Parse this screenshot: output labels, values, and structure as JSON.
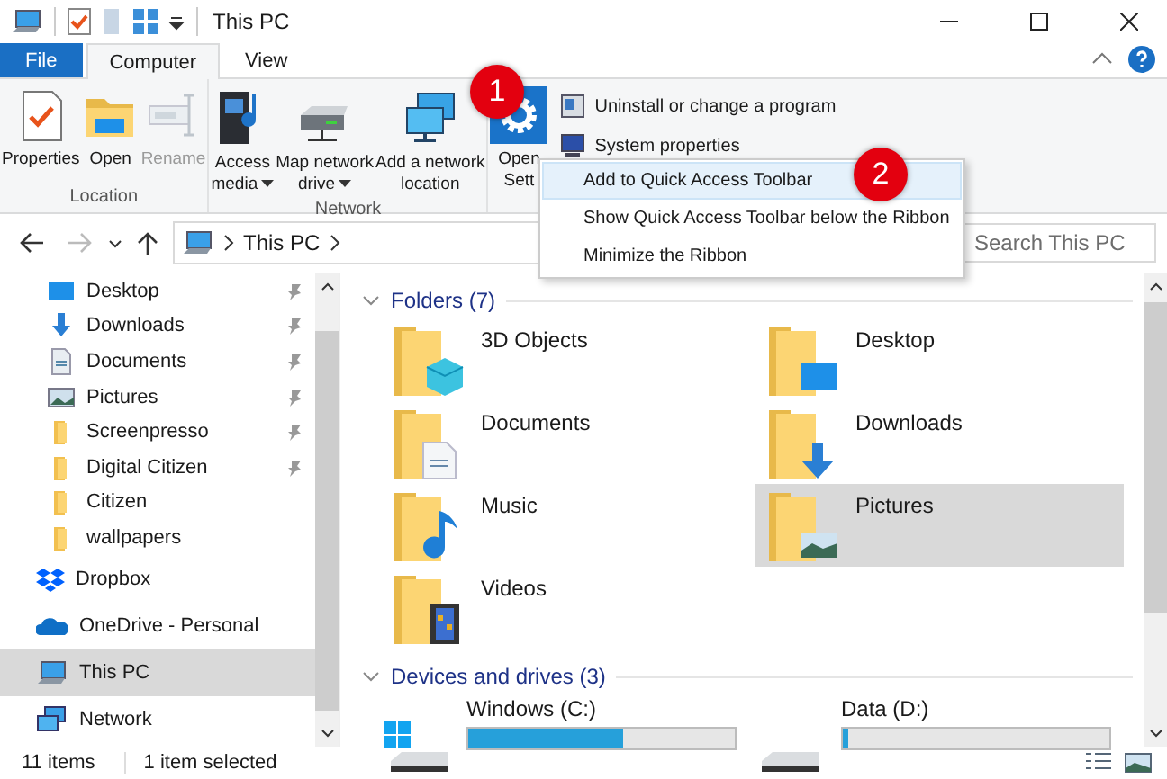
{
  "window": {
    "title": "This PC"
  },
  "tabs": [
    {
      "label": "File",
      "kind": "file",
      "selected": false
    },
    {
      "label": "Computer",
      "kind": "tab",
      "selected": true
    },
    {
      "label": "View",
      "kind": "tab",
      "selected": false
    }
  ],
  "ribbon_groups": [
    {
      "label": "Location",
      "buttons": [
        {
          "lines": [
            "Properties"
          ],
          "kind": "properties",
          "disabled": false,
          "dropdown": false
        },
        {
          "lines": [
            "Open"
          ],
          "kind": "folder",
          "disabled": false,
          "dropdown": false
        },
        {
          "lines": [
            "Rename"
          ],
          "kind": "rename",
          "disabled": true,
          "dropdown": false
        }
      ]
    },
    {
      "label": "Network",
      "buttons": [
        {
          "lines": [
            "Access",
            "media"
          ],
          "kind": "media",
          "disabled": false,
          "dropdown": true
        },
        {
          "lines": [
            "Map network",
            "drive"
          ],
          "kind": "drive",
          "disabled": false,
          "dropdown": true
        },
        {
          "lines": [
            "Add a network",
            "location"
          ],
          "kind": "network",
          "disabled": false,
          "dropdown": false
        }
      ]
    },
    {
      "buttons": [
        {
          "lines": [
            "Open",
            "Sett"
          ],
          "kind": "settings",
          "disabled": false,
          "dropdown": false
        }
      ],
      "small_buttons": [
        {
          "label": "Uninstall or change a program",
          "kind": "uninstall"
        },
        {
          "label": "System properties",
          "kind": "sysprops"
        }
      ]
    }
  ],
  "context_menu": [
    {
      "label": "Add to Quick Access Toolbar",
      "selected": true
    },
    {
      "label": "Show Quick Access Toolbar below the Ribbon",
      "selected": false
    },
    {
      "label": "Minimize the Ribbon",
      "selected": false
    }
  ],
  "step_badges": [
    "1",
    "2"
  ],
  "address": {
    "location": "This PC",
    "search_placeholder": "Search This PC"
  },
  "quick_access_items": [
    {
      "label": "Desktop",
      "kind": "desktop",
      "pinned": true
    },
    {
      "label": "Downloads",
      "kind": "downloads",
      "pinned": true
    },
    {
      "label": "Documents",
      "kind": "documents",
      "pinned": true
    },
    {
      "label": "Pictures",
      "kind": "pictures",
      "pinned": true
    },
    {
      "label": "Screenpresso",
      "kind": "folder",
      "pinned": true
    },
    {
      "label": "Digital Citizen",
      "kind": "folder",
      "pinned": true
    },
    {
      "label": "Citizen",
      "kind": "folder",
      "pinned": false
    },
    {
      "label": "wallpapers",
      "kind": "folder",
      "pinned": false
    }
  ],
  "nav_items": [
    {
      "label": "Dropbox",
      "kind": "dropbox",
      "selected": false
    },
    {
      "label": "OneDrive - Personal",
      "kind": "onedrive",
      "selected": false
    },
    {
      "label": "This PC",
      "kind": "pc",
      "selected": true
    },
    {
      "label": "Network",
      "kind": "network",
      "selected": false
    }
  ],
  "sections": [
    {
      "title": "Folders (7)",
      "kind": "folders",
      "items": [
        {
          "label": "3D Objects",
          "kind": "objects3d",
          "selected": false
        },
        {
          "label": "Desktop",
          "kind": "desktop",
          "selected": false
        },
        {
          "label": "Documents",
          "kind": "documents",
          "selected": false
        },
        {
          "label": "Downloads",
          "kind": "downloads",
          "selected": false
        },
        {
          "label": "Music",
          "kind": "music",
          "selected": false
        },
        {
          "label": "Pictures",
          "kind": "pictures",
          "selected": true
        },
        {
          "label": "Videos",
          "kind": "videos",
          "selected": false
        }
      ]
    },
    {
      "title": "Devices and drives (3)",
      "kind": "drives",
      "items": [
        {
          "label": "Windows (C:)",
          "kind": "windows",
          "level": 0.58
        },
        {
          "label": "Data (D:)",
          "kind": "disk",
          "level": 0.02
        }
      ]
    }
  ],
  "status_bar": {
    "count": "11 items",
    "selection": "1 item selected"
  }
}
